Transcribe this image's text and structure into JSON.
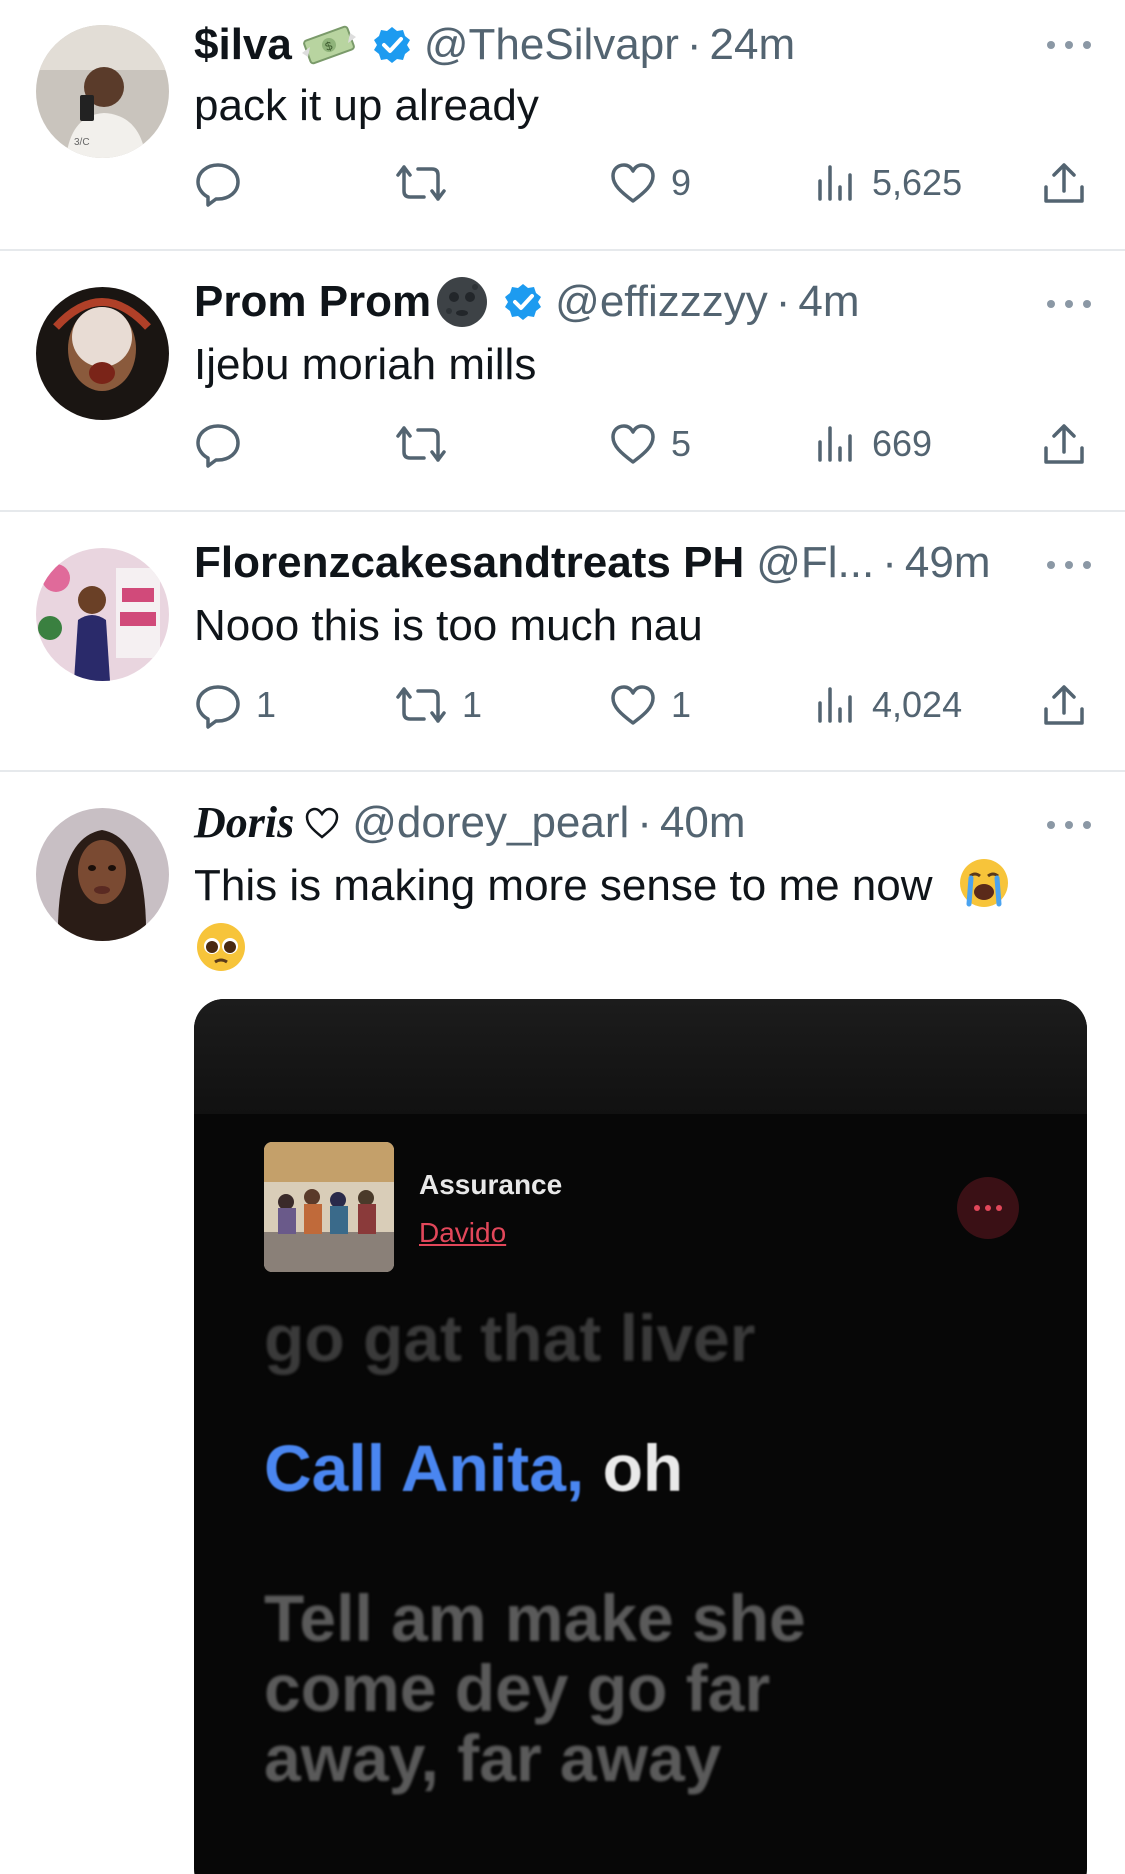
{
  "tweets": [
    {
      "name": "$ilva",
      "handle": "@TheSilvapr",
      "separator": "·",
      "time": "24m",
      "text": "pack it up already",
      "verified": true,
      "name_emoji": "money-with-wings",
      "actions": {
        "reply": "",
        "retweet": "",
        "like": "9",
        "views": "5,625"
      }
    },
    {
      "name": "Prom Prom",
      "handle": "@effizzzyy",
      "separator": "·",
      "time": "4m",
      "text": "Ijebu moriah mills",
      "verified": true,
      "name_emoji": "new-moon-face",
      "actions": {
        "reply": "",
        "retweet": "",
        "like": "5",
        "views": "669"
      }
    },
    {
      "name": "Florenzcakesandtreats PH",
      "handle": "@Fl...",
      "separator": "·",
      "time": "49m",
      "text": "Nooo this is too much nau",
      "verified": false,
      "actions": {
        "reply": "1",
        "retweet": "1",
        "like": "1",
        "views": "4,024"
      }
    },
    {
      "name": "Doris",
      "handle": "@dorey_pearl",
      "separator": "·",
      "time": "40m",
      "text": "This is making more sense to me now",
      "name_emoji": "heart-outline",
      "text_emojis": [
        "loudly-crying-face",
        "pleading-face"
      ],
      "verified": false
    }
  ],
  "media": {
    "song_title": "Assurance",
    "song_artist": "Davido",
    "lyrics": {
      "previous": "go gat that liver",
      "current_highlight": "Call Anita,",
      "current_rest": " oh",
      "next_1": "Tell am make she",
      "next_2": "come dey go far",
      "next_3": "away, far away"
    }
  },
  "colors": {
    "verified_blue": "#1d9bf0",
    "icon_gray": "#536471",
    "lyric_highlight": "#4a86f0",
    "artist_red": "#e2475a"
  }
}
